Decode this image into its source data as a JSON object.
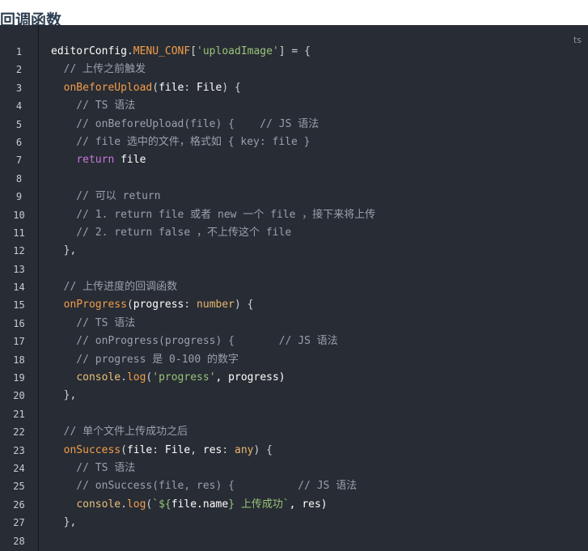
{
  "page": {
    "heading": "回调函数"
  },
  "code_block": {
    "language": "ts",
    "colors": {
      "background": "#282c34",
      "comment": "#9aa1ab",
      "string": "#98c379",
      "keyword": "#c678dd",
      "function": "#f29e4c",
      "plain": "#ffffff"
    },
    "lines": [
      {
        "number": "1",
        "tokens": [
          {
            "t": "editorConfig",
            "c": "plain"
          },
          {
            "t": ".",
            "c": "punct"
          },
          {
            "t": "MENU_CONF",
            "c": "func"
          },
          {
            "t": "[",
            "c": "punct"
          },
          {
            "t": "'uploadImage'",
            "c": "string"
          },
          {
            "t": "] = {",
            "c": "punct"
          }
        ]
      },
      {
        "number": "2",
        "tokens": [
          {
            "t": "  // 上传之前触发",
            "c": "comment"
          }
        ]
      },
      {
        "number": "3",
        "tokens": [
          {
            "t": "  ",
            "c": "plain"
          },
          {
            "t": "onBeforeUpload",
            "c": "func"
          },
          {
            "t": "(",
            "c": "punct"
          },
          {
            "t": "file",
            "c": "plain"
          },
          {
            "t": ": ",
            "c": "punct"
          },
          {
            "t": "File",
            "c": "plain"
          },
          {
            "t": ") {",
            "c": "punct"
          }
        ]
      },
      {
        "number": "4",
        "tokens": [
          {
            "t": "    // TS 语法",
            "c": "comment"
          }
        ]
      },
      {
        "number": "5",
        "tokens": [
          {
            "t": "    // onBeforeUpload(file) {    // JS 语法",
            "c": "comment"
          }
        ]
      },
      {
        "number": "6",
        "tokens": [
          {
            "t": "    // file 选中的文件，格式如 { key: file }",
            "c": "comment"
          }
        ]
      },
      {
        "number": "7",
        "tokens": [
          {
            "t": "    ",
            "c": "plain"
          },
          {
            "t": "return",
            "c": "keyword"
          },
          {
            "t": " file",
            "c": "plain"
          }
        ]
      },
      {
        "number": "8",
        "tokens": []
      },
      {
        "number": "9",
        "tokens": [
          {
            "t": "    // 可以 return",
            "c": "comment"
          }
        ]
      },
      {
        "number": "10",
        "tokens": [
          {
            "t": "    // 1. return file 或者 new 一个 file ，接下来将上传",
            "c": "comment"
          }
        ]
      },
      {
        "number": "11",
        "tokens": [
          {
            "t": "    // 2. return false ，不上传这个 file",
            "c": "comment"
          }
        ]
      },
      {
        "number": "12",
        "tokens": [
          {
            "t": "  },",
            "c": "punct"
          }
        ]
      },
      {
        "number": "13",
        "tokens": []
      },
      {
        "number": "14",
        "tokens": [
          {
            "t": "  // 上传进度的回调函数",
            "c": "comment"
          }
        ]
      },
      {
        "number": "15",
        "tokens": [
          {
            "t": "  ",
            "c": "plain"
          },
          {
            "t": "onProgress",
            "c": "func"
          },
          {
            "t": "(",
            "c": "punct"
          },
          {
            "t": "progress",
            "c": "plain"
          },
          {
            "t": ": ",
            "c": "punct"
          },
          {
            "t": "number",
            "c": "type"
          },
          {
            "t": ") {",
            "c": "punct"
          }
        ]
      },
      {
        "number": "16",
        "tokens": [
          {
            "t": "    // TS 语法",
            "c": "comment"
          }
        ]
      },
      {
        "number": "17",
        "tokens": [
          {
            "t": "    // onProgress(progress) {       // JS 语法",
            "c": "comment"
          }
        ]
      },
      {
        "number": "18",
        "tokens": [
          {
            "t": "    // progress 是 0-100 的数字",
            "c": "comment"
          }
        ]
      },
      {
        "number": "19",
        "tokens": [
          {
            "t": "    ",
            "c": "plain"
          },
          {
            "t": "console",
            "c": "prop"
          },
          {
            "t": ".",
            "c": "punct"
          },
          {
            "t": "log",
            "c": "func"
          },
          {
            "t": "(",
            "c": "punct"
          },
          {
            "t": "'progress'",
            "c": "string"
          },
          {
            "t": ", progress)",
            "c": "plain"
          }
        ]
      },
      {
        "number": "20",
        "tokens": [
          {
            "t": "  },",
            "c": "punct"
          }
        ]
      },
      {
        "number": "21",
        "tokens": []
      },
      {
        "number": "22",
        "tokens": [
          {
            "t": "  // 单个文件上传成功之后",
            "c": "comment"
          }
        ]
      },
      {
        "number": "23",
        "tokens": [
          {
            "t": "  ",
            "c": "plain"
          },
          {
            "t": "onSuccess",
            "c": "func"
          },
          {
            "t": "(",
            "c": "punct"
          },
          {
            "t": "file",
            "c": "plain"
          },
          {
            "t": ": ",
            "c": "punct"
          },
          {
            "t": "File",
            "c": "plain"
          },
          {
            "t": ", ",
            "c": "punct"
          },
          {
            "t": "res",
            "c": "plain"
          },
          {
            "t": ": ",
            "c": "punct"
          },
          {
            "t": "any",
            "c": "type"
          },
          {
            "t": ") {",
            "c": "punct"
          }
        ]
      },
      {
        "number": "24",
        "tokens": [
          {
            "t": "    // TS 语法",
            "c": "comment"
          }
        ]
      },
      {
        "number": "25",
        "tokens": [
          {
            "t": "    // onSuccess(file, res) {          // JS 语法",
            "c": "comment"
          }
        ]
      },
      {
        "number": "26",
        "tokens": [
          {
            "t": "    ",
            "c": "plain"
          },
          {
            "t": "console",
            "c": "prop"
          },
          {
            "t": ".",
            "c": "punct"
          },
          {
            "t": "log",
            "c": "func"
          },
          {
            "t": "(",
            "c": "punct"
          },
          {
            "t": "`${",
            "c": "string"
          },
          {
            "t": "file.name",
            "c": "plain"
          },
          {
            "t": "} 上传成功`",
            "c": "string"
          },
          {
            "t": ", res)",
            "c": "plain"
          }
        ]
      },
      {
        "number": "27",
        "tokens": [
          {
            "t": "  },",
            "c": "punct"
          }
        ]
      },
      {
        "number": "28",
        "tokens": []
      }
    ]
  }
}
